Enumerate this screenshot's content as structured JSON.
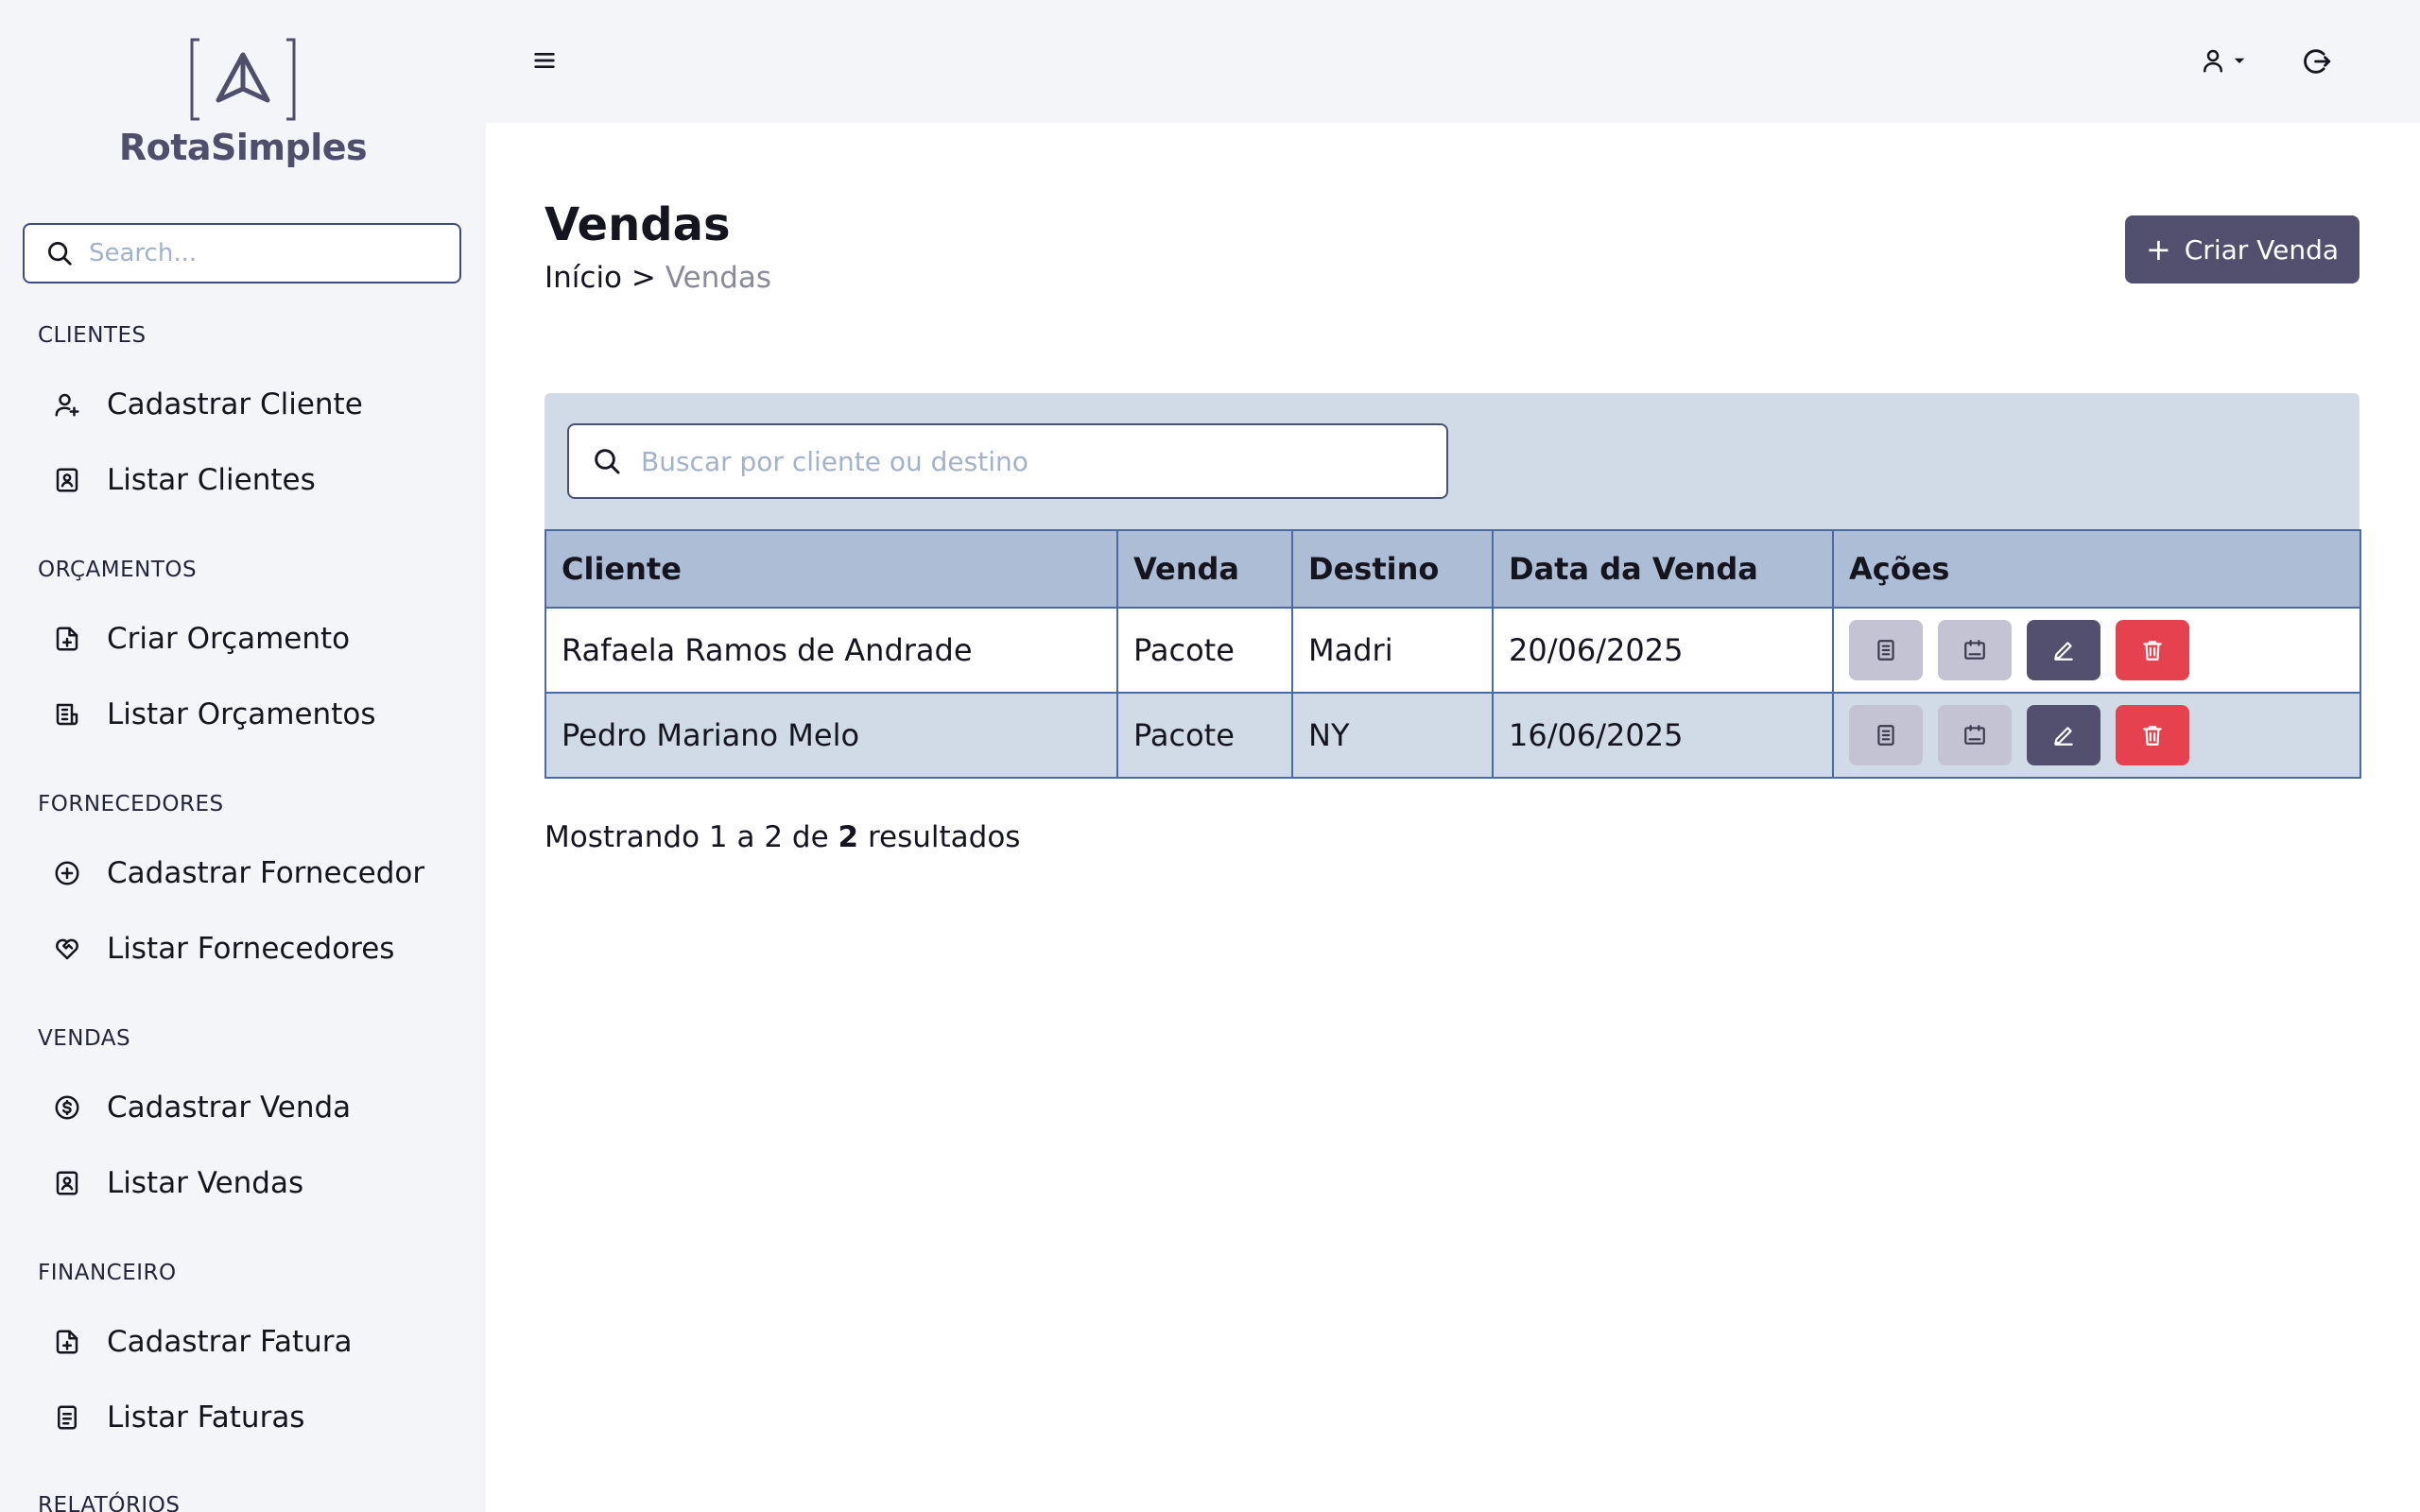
{
  "brand": {
    "name": "RotaSimples"
  },
  "sidebar": {
    "search_placeholder": "Search...",
    "sections": [
      {
        "title": "CLIENTES",
        "items": [
          {
            "label": "Cadastrar Cliente",
            "icon": "user-plus-icon"
          },
          {
            "label": "Listar Clientes",
            "icon": "contact-card-icon"
          }
        ]
      },
      {
        "title": "ORÇAMENTOS",
        "items": [
          {
            "label": "Criar Orçamento",
            "icon": "file-plus-icon"
          },
          {
            "label": "Listar Orçamentos",
            "icon": "file-list-icon"
          }
        ]
      },
      {
        "title": "FORNECEDORES",
        "items": [
          {
            "label": "Cadastrar Fornecedor",
            "icon": "circle-plus-icon"
          },
          {
            "label": "Listar Fornecedores",
            "icon": "heart-handshake-icon"
          }
        ]
      },
      {
        "title": "VENDAS",
        "items": [
          {
            "label": "Cadastrar Venda",
            "icon": "dollar-circle-icon"
          },
          {
            "label": "Listar Vendas",
            "icon": "contact-card-icon"
          }
        ]
      },
      {
        "title": "FINANCEIRO",
        "items": [
          {
            "label": "Cadastrar Fatura",
            "icon": "file-plus-icon"
          },
          {
            "label": "Listar Faturas",
            "icon": "file-text-icon"
          }
        ]
      },
      {
        "title": "RELATÓRIOS",
        "items": []
      }
    ]
  },
  "topbar": {
    "menu_icon": "hamburger-icon",
    "user_icon": "user-icon",
    "logout_icon": "logout-icon"
  },
  "page": {
    "title": "Vendas",
    "breadcrumb_home": "Início",
    "breadcrumb_sep": ">",
    "breadcrumb_current": "Vendas",
    "create_button": "Criar Venda",
    "create_icon": "+"
  },
  "table": {
    "search_placeholder": "Buscar por cliente ou destino",
    "columns": [
      "Cliente",
      "Venda",
      "Destino",
      "Data da Venda",
      "Ações"
    ],
    "rows": [
      {
        "cliente": "Rafaela Ramos de Andrade",
        "venda": "Pacote",
        "destino": "Madri",
        "data": "20/06/2025"
      },
      {
        "cliente": "Pedro Mariano Melo",
        "venda": "Pacote",
        "destino": "NY",
        "data": "16/06/2025"
      }
    ]
  },
  "results": {
    "prefix": "Mostrando 1 a 2 de",
    "total": "2",
    "suffix": "resultados"
  },
  "colors": {
    "primary": "#52506e",
    "danger": "#e5414e",
    "panel": "#d1dbe8",
    "header": "#aebdd6",
    "sidebar_bg": "#f4f5f9"
  }
}
